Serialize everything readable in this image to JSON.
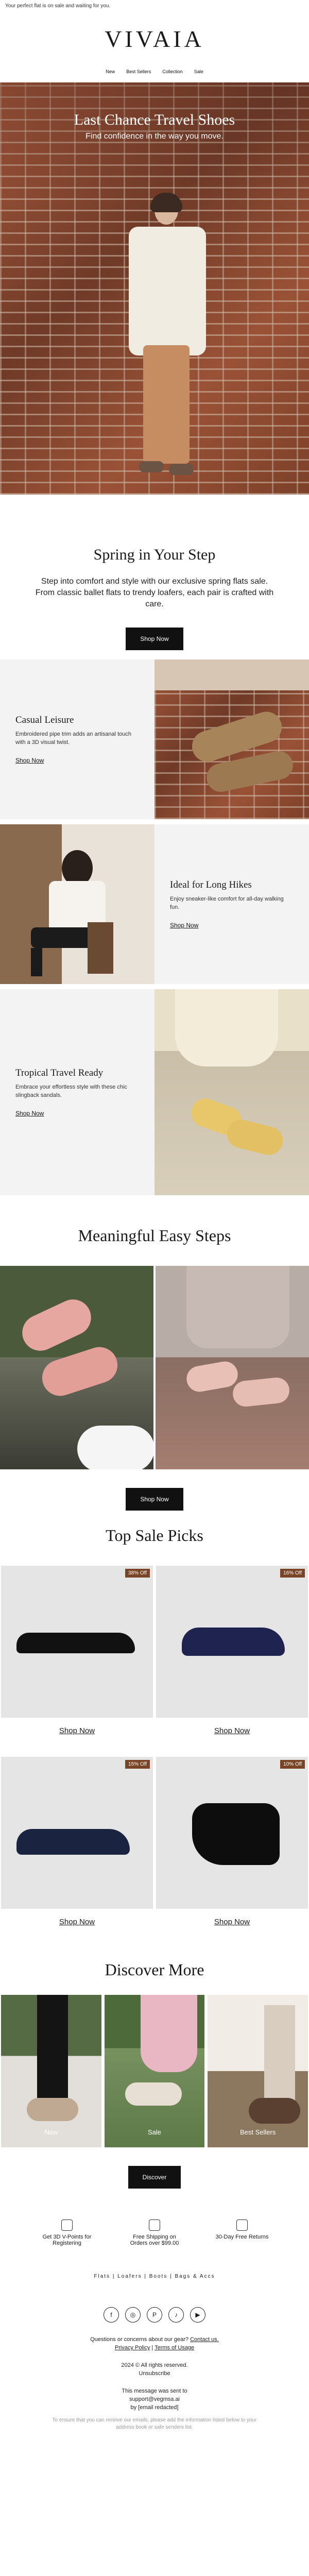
{
  "preheader": "Your perfect flat is on sale and waiting for you.",
  "brand": "VIVAIA",
  "nav": [
    "New",
    "Best Sellers",
    "Collection",
    "Sale"
  ],
  "hero": {
    "title": "Last Chance Travel Shoes",
    "subtitle": "Find confidence in the way you move."
  },
  "intro": {
    "title": "Spring in Your Step",
    "body": "Step into comfort and style with our exclusive spring flats sale. From classic ballet flats to trendy loafers, each pair is crafted with care.",
    "cta": "Shop Now"
  },
  "features": [
    {
      "title": "Casual Leisure",
      "body": "Embroidered pipe trim adds an artisanal touch with a 3D visual twist.",
      "link": "Shop Now"
    },
    {
      "title": "Ideal for Long Hikes",
      "body": "Enjoy sneaker-like comfort for all-day walking fun.",
      "link": "Shop Now"
    },
    {
      "title": "Tropical Travel Ready",
      "body": "Embrace your effortless style with these chic slingback sandals.",
      "link": "Shop Now"
    }
  ],
  "steps": {
    "title": "Meaningful Easy Steps",
    "cta": "Shop Now"
  },
  "picks": {
    "title": "Top Sale Picks",
    "items": [
      {
        "badge": "38% Off",
        "link": "Shop Now",
        "color": "#111111"
      },
      {
        "badge": "16% Off",
        "link": "Shop Now",
        "color": "#1e2350"
      },
      {
        "badge": "15% Off",
        "link": "Shop Now",
        "color": "#1a2340"
      },
      {
        "badge": "10% Off",
        "link": "Shop Now",
        "color": "#0d0d0d"
      }
    ]
  },
  "discover": {
    "title": "Discover More",
    "tiles": [
      "New",
      "Sale",
      "Best Sellers"
    ],
    "cta": "Discover"
  },
  "perks": [
    "Get 3D V-Points for Registering",
    "Free Shipping on Orders over $99.00",
    "30-Day Free Returns"
  ],
  "footer_nav": "Flats | Loafers | Boots | Bags & Accs",
  "social": [
    "f",
    "◎",
    "P",
    "♪",
    "▶"
  ],
  "footer": {
    "question": "Questions or concerns about our gear?",
    "contact": "Contact us.",
    "privacy": "Privacy Policy",
    "terms": "Terms of Usage",
    "rights": "2024 © All rights reserved.",
    "unsubscribe": "Unsubscribe",
    "sent1": "This message was sent to",
    "sent2": "support@vegmsa.ai",
    "sent3": "by [email redacted]",
    "fine": "To ensure that you can receive our emails, please add the information listed below to your address book or safe senders list."
  },
  "colors": {
    "accent": "#111111",
    "badge": "#7a4426",
    "panel": "#f3f3f3"
  }
}
